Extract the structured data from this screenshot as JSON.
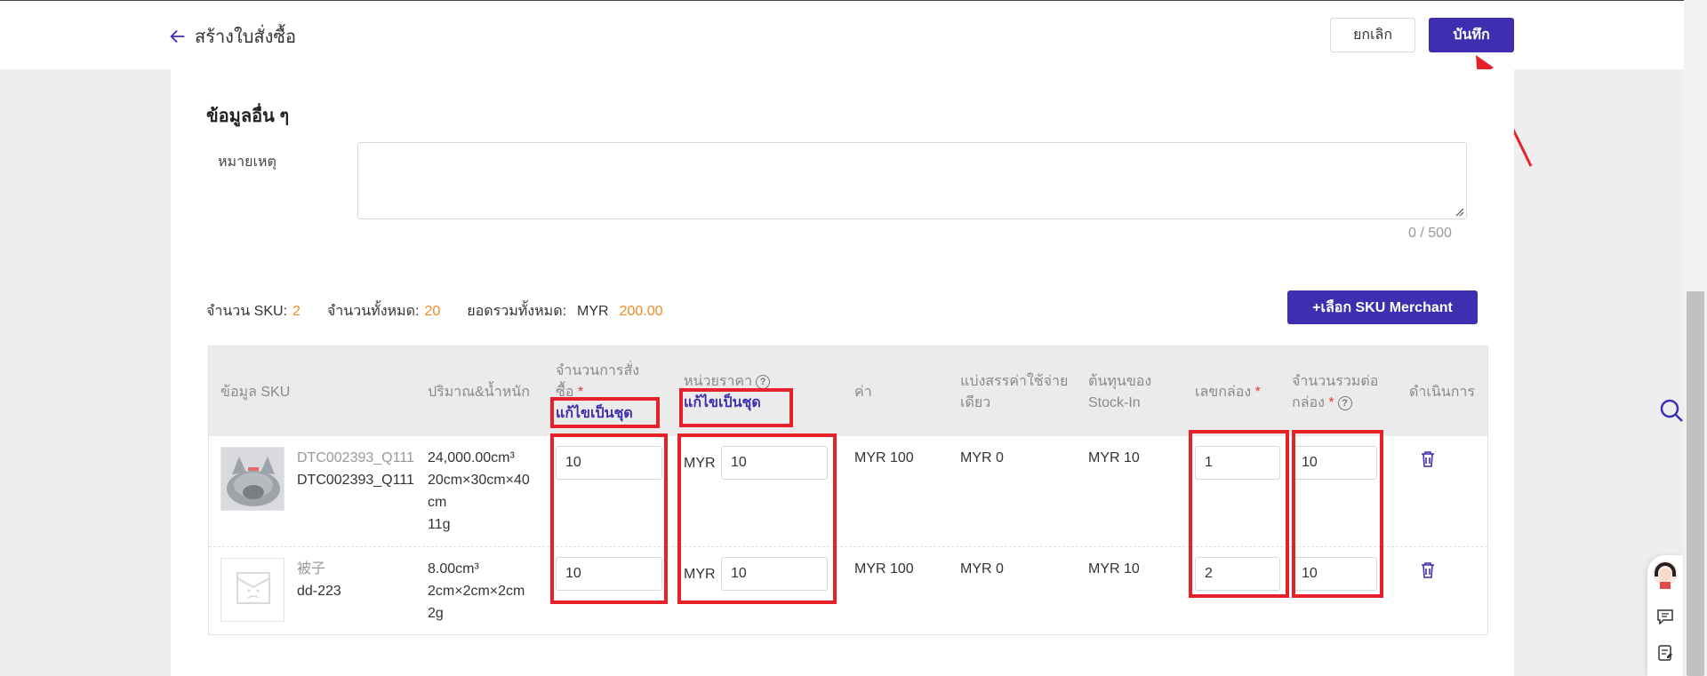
{
  "header": {
    "back_title": "สร้างใบสั่งซื้อ",
    "cancel_label": "ยกเลิก",
    "save_label": "บันทึก"
  },
  "other_info": {
    "title": "ข้อมูลอื่น ๆ",
    "remark_label": "หมายเหตุ",
    "remark_value": "",
    "counter": "0 / 500"
  },
  "summary": {
    "sku_count_label": "จำนวน SKU:",
    "sku_count": "2",
    "total_qty_label": "จำนวนทั้งหมด:",
    "total_qty": "20",
    "total_amount_label": "ยอดรวมทั้งหมด:",
    "currency": "MYR",
    "total_amount": "200.00",
    "add_button": "+เลือก SKU Merchant"
  },
  "table": {
    "headers": {
      "sku_info": "ข้อมูล SKU",
      "volume_weight": "ปริมาณ&น้ำหนัก",
      "order_qty_line1": "จำนวนการสั่ง",
      "order_qty_line2": "ซื้อ",
      "order_qty_link": "แก้ไขเป็นชุด",
      "unit_price": "หน่วยราคา",
      "unit_price_link": "แก้ไขเป็นชุด",
      "value": "ค่า",
      "shared_cost_line1": "แบ่งสรรค่าใช้จ่าย",
      "shared_cost_line2": "เดียว",
      "stockin_cost_line1": "ต้นทุนของ",
      "stockin_cost_line2": "Stock-In",
      "box_no": "เลขกล่อง",
      "qty_per_box_line1": "จำนวนรวมต่อ",
      "qty_per_box_line2": "กล่อง",
      "actions": "ดำเนินการ"
    },
    "rows": [
      {
        "sku_name": "DTC002393_Q111",
        "sku_code": "DTC002393_Q111",
        "volume": "24,000.00cm³",
        "dims_line1": "20cm×30cm×40",
        "dims_line2": "cm",
        "weight": "11g",
        "order_qty": "10",
        "price_currency": "MYR",
        "unit_price": "10",
        "value": "MYR 100",
        "shared_cost": "MYR 0",
        "stockin_cost": "MYR 10",
        "box_no": "1",
        "qty_per_box": "10"
      },
      {
        "sku_name": "被子",
        "sku_code": "dd-223",
        "volume": "8.00cm³",
        "dims_line1": "2cm×2cm×2cm",
        "dims_line2": "",
        "weight": "2g",
        "order_qty": "10",
        "price_currency": "MYR",
        "unit_price": "10",
        "value": "MYR 100",
        "shared_cost": "MYR 0",
        "stockin_cost": "MYR 10",
        "box_no": "2",
        "qty_per_box": "10"
      }
    ]
  },
  "colors": {
    "primary": "#3d2fb0",
    "accent_orange": "#f08a24",
    "highlight_red": "#e8202a"
  },
  "icons": [
    "arrow-left-icon",
    "help-circle-icon",
    "trash-icon",
    "search-icon",
    "chat-icon",
    "notes-icon"
  ]
}
